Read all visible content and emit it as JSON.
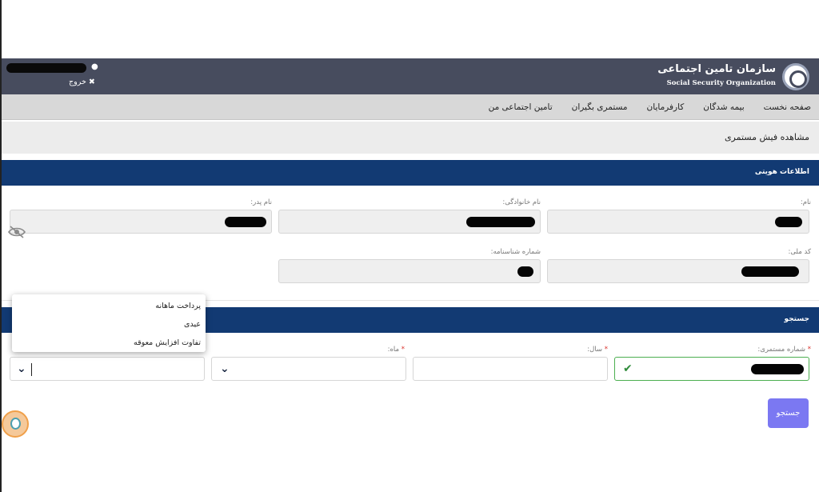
{
  "header": {
    "logo_fa": "سازمان تامین اجتماعی",
    "logo_en": "Social Security Organization",
    "user_icon": "user-icon",
    "logout_label": "✖ خروج"
  },
  "nav": {
    "items": [
      "صفحه نخست",
      "بیمه شدگان",
      "کارفرمایان",
      "مستمری بگیران",
      "تامین اجتماعی من"
    ]
  },
  "page": {
    "title": "مشاهده فیش مستمری"
  },
  "identity": {
    "section_title": "اطلاعات هویتی",
    "first_name_label": "نام:",
    "last_name_label": "نام خانوادگی:",
    "father_name_label": "نام پدر:",
    "national_code_label": "کد ملی:",
    "id_number_label": "شماره شناسنامه:"
  },
  "search": {
    "section_title": "جستجو",
    "pension_number_label": "شماره مستمری:",
    "year_label": "سال:",
    "month_label": "ماه:",
    "required_mark": "*",
    "button_label": "جستجو"
  },
  "dropdown": {
    "options": [
      "پرداخت ماهانه",
      "عیدی",
      "تفاوت افزایش معوقه"
    ]
  },
  "colors": {
    "header_bg": "#474c5e",
    "section_bg": "#123a73",
    "accent_button": "#7b78f2",
    "valid_green": "#4caf50",
    "required_red": "#d9322c"
  }
}
